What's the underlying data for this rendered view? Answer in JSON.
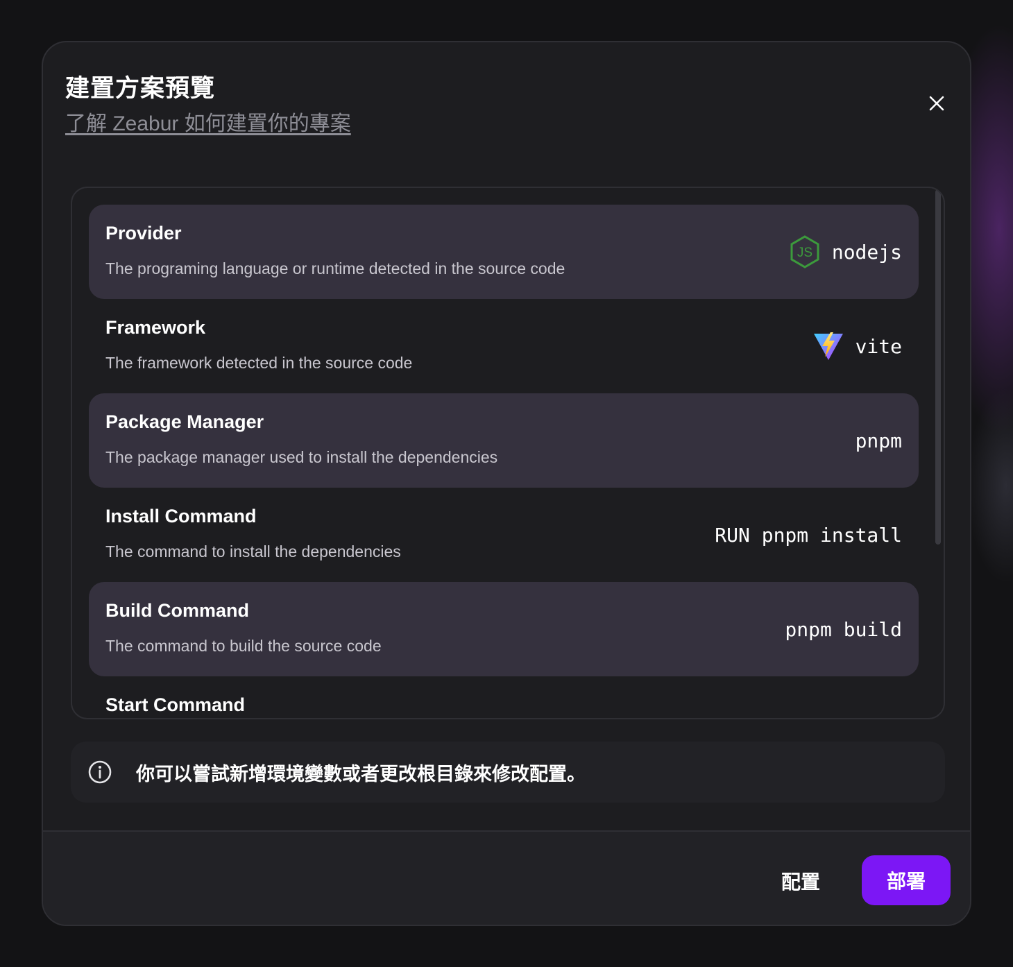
{
  "dialog": {
    "title": "建置方案預覽",
    "learn_link": "了解 Zeabur 如何建置你的專案"
  },
  "plan_rows": [
    {
      "title": "Provider",
      "description": "The programing language or runtime detected in the source code",
      "value": "nodejs",
      "icon": "nodejs-icon"
    },
    {
      "title": "Framework",
      "description": "The framework detected in the source code",
      "value": "vite",
      "icon": "vite-icon"
    },
    {
      "title": "Package Manager",
      "description": "The package manager used to install the dependencies",
      "value": "pnpm"
    },
    {
      "title": "Install Command",
      "description": "The command to install the dependencies",
      "value": "RUN pnpm install"
    },
    {
      "title": "Build Command",
      "description": "The command to build the source code",
      "value": "pnpm build"
    },
    {
      "title": "Start Command"
    }
  ],
  "info": {
    "icon": "info-icon",
    "text": "你可以嘗試新增環境變數或者更改根目錄來修改配置。"
  },
  "footer": {
    "config_label": "配置",
    "deploy_label": "部署"
  },
  "colors": {
    "accent": "#7c17f5",
    "nodejs_green": "#3c9a3c",
    "row_shade": "#35313e"
  }
}
